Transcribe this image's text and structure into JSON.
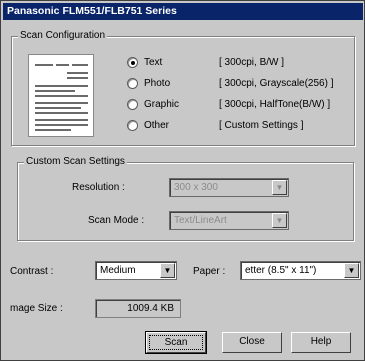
{
  "window": {
    "title": "Panasonic FLM551/FLB751 Series"
  },
  "scan_config": {
    "legend": "Scan Configuration",
    "options": [
      {
        "label": "Text",
        "desc": "[ 300cpi, B/W ]",
        "selected": true
      },
      {
        "label": "Photo",
        "desc": "[ 300cpi, Grayscale(256) ]",
        "selected": false
      },
      {
        "label": "Graphic",
        "desc": "[ 300cpi, HalfTone(B/W) ]",
        "selected": false
      },
      {
        "label": "Other",
        "desc": "[ Custom Settings ]",
        "selected": false
      }
    ]
  },
  "custom": {
    "legend": "Custom Scan Settings",
    "resolution_label": "Resolution :",
    "resolution_value": "300 x 300",
    "scan_mode_label": "Scan Mode :",
    "scan_mode_value": "Text/LineArt"
  },
  "contrast": {
    "label": "Contrast :",
    "value": "Medium"
  },
  "paper": {
    "label": "Paper :",
    "value": "etter (8.5\" x 11\")"
  },
  "image_size": {
    "label": "mage Size :",
    "value": "1009.4 KB"
  },
  "buttons": {
    "scan": "Scan",
    "close": "Close",
    "help": "Help"
  }
}
